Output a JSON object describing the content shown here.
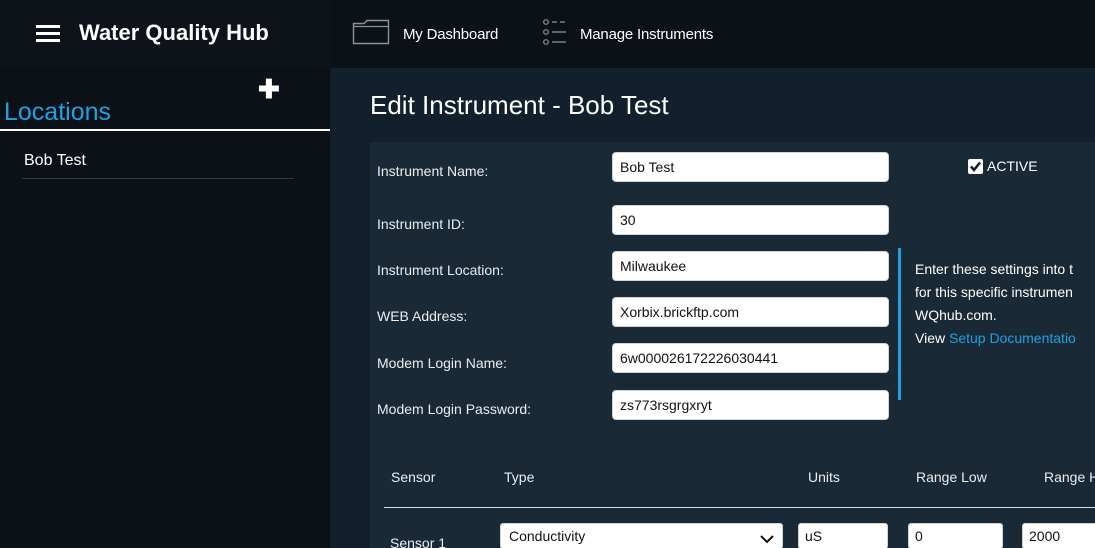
{
  "header": {
    "app_title": "Water Quality Hub",
    "nav": [
      {
        "label": "My Dashboard",
        "icon": "folder-icon"
      },
      {
        "label": "Manage Instruments",
        "icon": "list-icon"
      }
    ]
  },
  "sidebar": {
    "title": "Locations",
    "add_icon": "plus-icon",
    "items": [
      {
        "label": "Bob Test"
      }
    ]
  },
  "main": {
    "title": "Edit Instrument - Bob Test",
    "fields": [
      {
        "label": "Instrument Name:",
        "value": "Bob Test"
      },
      {
        "label": "Instrument ID:",
        "value": "30"
      },
      {
        "label": "Instrument Location:",
        "value": "Milwaukee"
      },
      {
        "label": "WEB Address:",
        "value": "Xorbix.brickftp.com"
      },
      {
        "label": "Modem Login Name:",
        "value": "6w000026172226030441"
      },
      {
        "label": "Modem Login Password:",
        "value": "zs773rsgrgxryt"
      }
    ],
    "active": {
      "label": "ACTIVE",
      "checked": true
    },
    "info": {
      "line1": "Enter these settings into t",
      "line2": "for this specific instrumen",
      "line3": "WQhub.com.",
      "view_prefix": "View ",
      "link": "Setup Documentatio"
    },
    "sensor_table": {
      "headers": [
        "Sensor",
        "Type",
        "Units",
        "Range Low",
        "Range H"
      ],
      "rows": [
        {
          "sensor": "Sensor 1",
          "type": "Conductivity",
          "units": "uS",
          "range_low": "0",
          "range_high": "2000"
        }
      ]
    }
  },
  "colors": {
    "accent": "#1ea2e2",
    "topbar": "#0b1117",
    "panel": "#1a2936",
    "background": "#12202d"
  }
}
